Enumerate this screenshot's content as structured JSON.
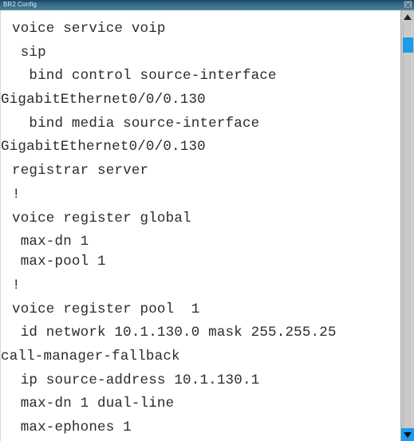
{
  "window": {
    "title": "BR2 Config",
    "close_label": "×",
    "accent_color": "#1a9bec",
    "titlebar_color": "#2b5d7d"
  },
  "config": {
    "lines": [
      {
        "text": "voice service voip",
        "indent": "normal"
      },
      {
        "text": " sip",
        "indent": "normal"
      },
      {
        "text": "  bind control source-interface",
        "indent": "normal"
      },
      {
        "text": "GigabitEthernet0/0/0.130",
        "indent": "cont"
      },
      {
        "text": "  bind media source-interface",
        "indent": "normal"
      },
      {
        "text": "GigabitEthernet0/0/0.130",
        "indent": "cont"
      },
      {
        "text": "registrar server",
        "indent": "normal"
      },
      {
        "text": "!",
        "indent": "normal"
      },
      {
        "text": "voice register global",
        "indent": "normal"
      },
      {
        "text": " max-dn 1",
        "indent": "tight"
      },
      {
        "text": " max-pool 1",
        "indent": "normal"
      },
      {
        "text": "!",
        "indent": "normal"
      },
      {
        "text": "voice register pool  1",
        "indent": "normal"
      },
      {
        "text": " id network 10.1.130.0 mask 255.255.25",
        "indent": "normal"
      },
      {
        "text": "call-manager-fallback",
        "indent": "cont"
      },
      {
        "text": " ip source-address 10.1.130.1",
        "indent": "normal"
      },
      {
        "text": " max-dn 1 dual-line",
        "indent": "normal"
      },
      {
        "text": " max-ephones 1",
        "indent": "normal"
      }
    ]
  },
  "scrollbar": {
    "up_icon": "arrow-up-icon",
    "down_icon": "arrow-down-icon",
    "thumb_label": "scroll-thumb"
  }
}
